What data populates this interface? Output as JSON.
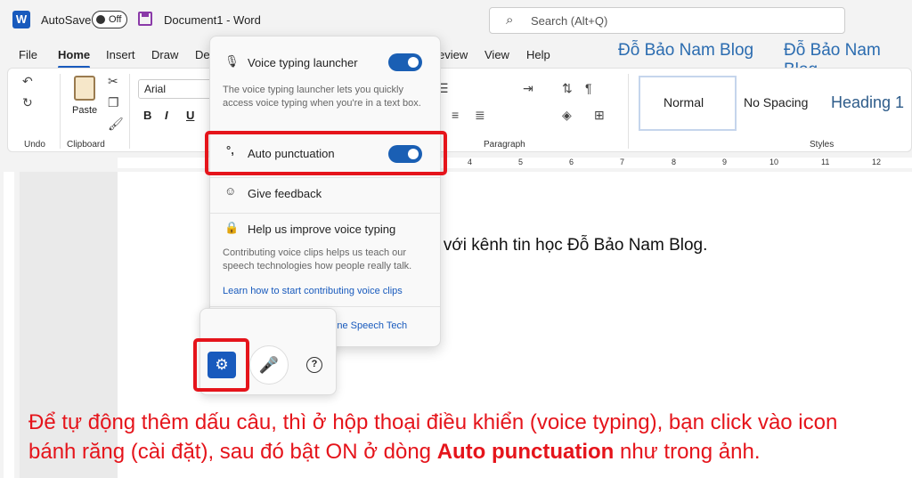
{
  "titlebar": {
    "app_letter": "W",
    "autosave_label": "AutoSave",
    "autosave_state": "Off",
    "document_title": "Document1  -  Word",
    "search_placeholder": "Search (Alt+Q)"
  },
  "menu": {
    "items": [
      "File",
      "Home",
      "Insert",
      "Draw",
      "De",
      "eview",
      "View",
      "Help"
    ],
    "active": "Home"
  },
  "blog_marks": [
    "Đỗ Bảo Nam Blog",
    "Đỗ Bảo Nam Blog"
  ],
  "ribbon": {
    "undo_label": "Undo",
    "clipboard_label": "Clipboard",
    "paste_label": "Paste",
    "font_name": "Arial",
    "paragraph_label": "Paragraph",
    "styles_label": "Styles",
    "styles": [
      "Normal",
      "No Spacing",
      "Heading 1"
    ]
  },
  "ruler": {
    "ticks": [
      "4",
      "5",
      "6",
      "7",
      "8",
      "9",
      "10",
      "11",
      "12"
    ]
  },
  "document": {
    "text": "n với kênh tin học Đỗ Bảo Nam Blog."
  },
  "voice_panel": {
    "launcher_label": "Voice typing launcher",
    "launcher_desc": "The voice typing launcher lets you quickly access voice typing when you're in a text box.",
    "auto_punct_label": "Auto punctuation",
    "feedback_label": "Give feedback",
    "improve_label": "Help us improve voice typing",
    "improve_desc": "Contributing voice clips helps us teach our speech technologies how people really talk.",
    "learn_link": "Learn how to start contributing voice clips",
    "powered_link": "Powered by Microsoft Online Speech Tech",
    "accent_color": "#1a5fb4"
  },
  "caption": {
    "line1": "Để tự động thêm dấu câu, thì ở hộp thoại điều khiển (voice typing), bạn click vào icon",
    "line2_a": "bánh răng (cài đặt), sau đó bật ON ở dòng ",
    "line2_b": "Auto punctuation",
    "line2_c": " như trong ảnh.",
    "color": "#e5141b"
  }
}
